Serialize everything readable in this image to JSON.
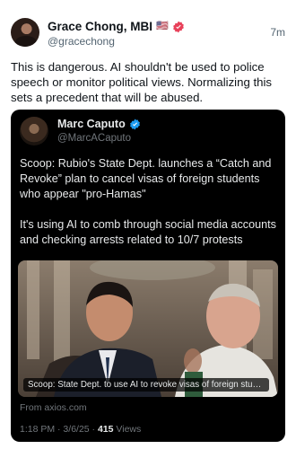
{
  "author": {
    "name": "Grace Chong, MBI",
    "flag": "🇺🇸",
    "handle": "@gracechong",
    "time": "7m"
  },
  "post_text": "This is dangerous. AI shouldn't be used to police speech or monitor political views. Normalizing this sets a precedent that will be abused.",
  "quoted": {
    "name": "Marc Caputo",
    "handle": "@MarcACaputo",
    "text": "Scoop: Rubio's State Dept. launches a “Catch and Revoke” plan to cancel visas of foreign students who appear \"pro-Hamas\"\n\nIt's using AI to comb through social media accounts and checking arrests related to 10/7 protests",
    "card": {
      "caption": "Scoop: State Dept. to use AI to revoke visas of foreign students w...",
      "source": "From axios.com"
    },
    "meta": {
      "timestamp": "1:18 PM · 3/6/25 · ",
      "views_count": "415",
      "views_label": " Views"
    }
  },
  "colors": {
    "verified_blue": "#1d9bf0",
    "badge_red": "#e8415a",
    "text_primary": "#0f1419",
    "text_secondary": "#536471"
  },
  "icons": [
    "verified-badge-icon",
    "red-badge-icon",
    "us-flag-icon"
  ]
}
